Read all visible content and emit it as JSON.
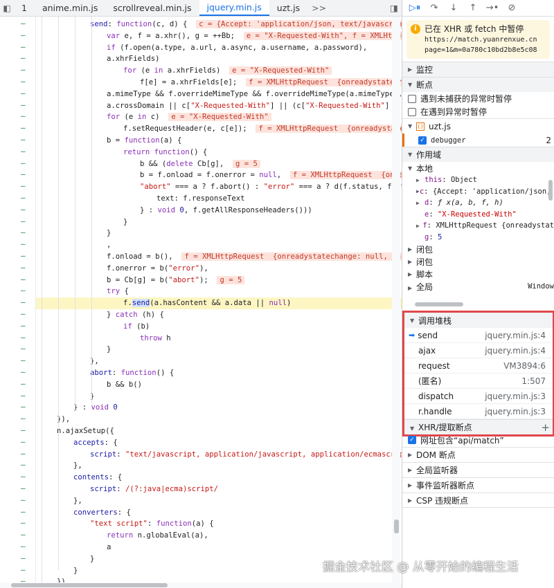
{
  "tabs": {
    "line_counter": "1",
    "items": [
      "anime.min.js",
      "scrollreveal.min.js",
      "jquery.min.js",
      "uzt.js"
    ],
    "more": ">>"
  },
  "code": {
    "lines": [
      [
        {
          "t": "send",
          "c": "fn"
        },
        {
          "t": ": "
        },
        {
          "t": "function",
          "c": "kw"
        },
        {
          "t": "(c, d) {  "
        },
        {
          "t": "c = {Accept: 'application/json, text/javascript, ",
          "c": "inl"
        }
      ],
      [
        {
          "t": "var",
          "c": "kw"
        },
        {
          "t": " e, f = a.xhr(), g = ++Bb;  "
        },
        {
          "t": "e = \"X-Requested-With\", f = XMLHttpRe",
          "c": "inl"
        }
      ],
      [
        {
          "t": "if",
          "c": "kw"
        },
        {
          "t": " (f.open(a.type, a.url, a.async, a.username, a.password),"
        }
      ],
      [
        {
          "t": "a.xhrFields)"
        }
      ],
      [
        {
          "t": "for",
          "c": "kw"
        },
        {
          "t": " (e "
        },
        {
          "t": "in",
          "c": "kw"
        },
        {
          "t": " a.xhrFields)  "
        },
        {
          "t": "e = \"X-Requested-With\"",
          "c": "inl"
        }
      ],
      [
        {
          "t": "f[e] = a.xhrFields[e];  "
        },
        {
          "t": "f = XMLHttpRequest  {onreadystatecha",
          "c": "inl"
        }
      ],
      [
        {
          "t": "a.mimeType && f.overrideMimeType && f.overrideMimeType(a.mimeType),"
        }
      ],
      [
        {
          "t": "a.crossDomain || c["
        },
        {
          "t": "\"X-Requested-With\"",
          "c": "str"
        },
        {
          "t": "] || (c["
        },
        {
          "t": "\"X-Requested-With\"",
          "c": "str"
        },
        {
          "t": "] = \"X"
        }
      ],
      [
        {
          "t": "for",
          "c": "kw"
        },
        {
          "t": " (e "
        },
        {
          "t": "in",
          "c": "kw"
        },
        {
          "t": " c)  "
        },
        {
          "t": "e = \"X-Requested-With\"",
          "c": "inl"
        }
      ],
      [
        {
          "t": "f.setRequestHeader(e, c[e]);  "
        },
        {
          "t": "f = XMLHttpRequest  {onreadystatec",
          "c": "inl"
        }
      ],
      [
        {
          "t": "b = "
        },
        {
          "t": "function",
          "c": "kw"
        },
        {
          "t": "(a) {"
        }
      ],
      [
        {
          "t": "return",
          "c": "kw"
        },
        {
          "t": " "
        },
        {
          "t": "function",
          "c": "kw"
        },
        {
          "t": "() {"
        }
      ],
      [
        {
          "t": "b && ("
        },
        {
          "t": "delete",
          "c": "kw"
        },
        {
          "t": " Cb[g],  "
        },
        {
          "t": "g = 5",
          "c": "inl"
        }
      ],
      [
        {
          "t": "b = f.onload = f.onerror = "
        },
        {
          "t": "null",
          "c": "kw"
        },
        {
          "t": ",  "
        },
        {
          "t": "f = XMLHttpRequest  {onrea",
          "c": "inl"
        }
      ],
      [
        {
          "t": "\"abort\"",
          "c": "str"
        },
        {
          "t": " === a ? f.abort() : "
        },
        {
          "t": "\"error\"",
          "c": "str"
        },
        {
          "t": " === a ? d(f.status, f.sta"
        }
      ],
      [
        {
          "t": "text: f.responseText"
        }
      ],
      [
        {
          "t": "} : "
        },
        {
          "t": "void",
          "c": "kw"
        },
        {
          "t": " "
        },
        {
          "t": "0",
          "c": "fn"
        },
        {
          "t": ", f.getAllResponseHeaders()))"
        }
      ],
      [
        {
          "t": "}"
        }
      ],
      [
        {
          "t": "}"
        }
      ],
      [
        {
          "t": ","
        }
      ],
      [
        {
          "t": "f.onload = b(),  "
        },
        {
          "t": "f = XMLHttpRequest  {onreadystatechange: null, read",
          "c": "inl"
        }
      ],
      [
        {
          "t": "f.onerror = b("
        },
        {
          "t": "\"error\"",
          "c": "str"
        },
        {
          "t": "),"
        }
      ],
      [
        {
          "t": "b = Cb[g] = b("
        },
        {
          "t": "\"abort\"",
          "c": "str"
        },
        {
          "t": ");  "
        },
        {
          "t": "g = 5",
          "c": "inl"
        }
      ],
      [
        {
          "t": "try",
          "c": "kw"
        },
        {
          "t": " {"
        }
      ],
      [
        {
          "t": "f."
        },
        {
          "t": "send",
          "c": "call"
        },
        {
          "t": "(a.hasContent && a.data || "
        },
        {
          "t": "null",
          "c": "kw"
        },
        {
          "t": ")"
        }
      ],
      [
        {
          "t": "} "
        },
        {
          "t": "catch",
          "c": "kw"
        },
        {
          "t": " (h) {"
        }
      ],
      [
        {
          "t": "if",
          "c": "kw"
        },
        {
          "t": " (b)"
        }
      ],
      [
        {
          "t": "throw",
          "c": "kw"
        },
        {
          "t": " h"
        }
      ],
      [
        {
          "t": "}"
        }
      ],
      [
        {
          "t": "},"
        }
      ],
      [
        {
          "t": "abort",
          "c": "fn"
        },
        {
          "t": ": "
        },
        {
          "t": "function",
          "c": "kw"
        },
        {
          "t": "() {"
        }
      ],
      [
        {
          "t": "b && b()"
        }
      ],
      [
        {
          "t": "}"
        }
      ],
      [
        {
          "t": "} : "
        },
        {
          "t": "void",
          "c": "kw"
        },
        {
          "t": " "
        },
        {
          "t": "0",
          "c": "fn"
        }
      ],
      [
        {
          "t": "}),"
        }
      ],
      [
        {
          "t": "n.ajaxSetup({"
        }
      ],
      [
        {
          "t": "accepts",
          "c": "fn"
        },
        {
          "t": ": {"
        }
      ],
      [
        {
          "t": "script",
          "c": "fn"
        },
        {
          "t": ": "
        },
        {
          "t": "\"text/javascript, application/javascript, application/ecmascript,",
          "c": "str"
        }
      ],
      [
        {
          "t": "},"
        }
      ],
      [
        {
          "t": "contents",
          "c": "fn"
        },
        {
          "t": ": {"
        }
      ],
      [
        {
          "t": "script",
          "c": "fn"
        },
        {
          "t": ": "
        },
        {
          "t": "/(?:java|ecma)script/",
          "c": "str"
        }
      ],
      [
        {
          "t": "},"
        }
      ],
      [
        {
          "t": "converters",
          "c": "fn"
        },
        {
          "t": ": {"
        }
      ],
      [
        {
          "t": "\"text script\"",
          "c": "str"
        },
        {
          "t": ": "
        },
        {
          "t": "function",
          "c": "kw"
        },
        {
          "t": "(a) {"
        }
      ],
      [
        {
          "t": "return",
          "c": "kw"
        },
        {
          "t": " n.globalEval(a),"
        }
      ],
      [
        {
          "t": "a"
        }
      ],
      [
        {
          "t": "}"
        }
      ],
      [
        {
          "t": "}"
        }
      ],
      [
        {
          "t": "}),"
        }
      ]
    ],
    "highlighted_line": 24
  },
  "toolbar": {
    "icons": [
      "resume-icon",
      "step-over-icon",
      "step-into-icon",
      "step-out-icon",
      "step-icon",
      "deactivate-breakpoints-icon"
    ]
  },
  "paused": {
    "title": "已在 XHR 或 fetch 中暂停",
    "url_line1": "https://match.yuanrenxue.cn",
    "url_line2": "page=1&m=0a780c10bd2b8e5c08"
  },
  "sections": {
    "watch": "监控",
    "breakpoints": "断点",
    "pause_uncaught": "遇到未捕获的异常时暂停",
    "pause_caught": "在遇到异常时暂停",
    "bp_file": "uzt.js",
    "bp_code": "debugger",
    "bp_line": "2",
    "scope": "作用域",
    "local": "本地",
    "closure1": "闭包",
    "closure2": "闭包",
    "script": "脚本",
    "global": "全局",
    "global_value": "Window"
  },
  "scope": {
    "this_key": "this",
    "this_val": "Object",
    "c_key": "c",
    "c_val": "{Accept: 'application/json, t",
    "d_key": "d",
    "d_val": "ƒ x(a, b, f, h)",
    "e_key": "e",
    "e_val": "\"X-Requested-With\"",
    "f_key": "f",
    "f_val": "XMLHttpRequest  {onreadystat",
    "g_key": "g",
    "g_val": "5"
  },
  "call_stack": {
    "header": "调用堆栈",
    "frames": [
      {
        "name": "send",
        "loc": "jquery.min.js:4"
      },
      {
        "name": "ajax",
        "loc": "jquery.min.js:4"
      },
      {
        "name": "request",
        "loc": "VM3894:6"
      },
      {
        "name": "(匿名)",
        "loc": "1:507"
      },
      {
        "name": "dispatch",
        "loc": "jquery.min.js:3"
      },
      {
        "name": "r.handle",
        "loc": "jquery.min.js:3"
      }
    ]
  },
  "lower": {
    "xhr_breakpoints": "XHR/提取断点",
    "add": "+",
    "url_contains": "网址包含“api/match”",
    "dom_breakpoints": "DOM 断点",
    "global_listeners": "全局监听器",
    "event_listener_breakpoints": "事件监听器断点",
    "csp_breakpoints": "CSP 违规断点"
  },
  "watermark": "掘金技术社区 @ 从零开始的编程生活",
  "colors": {
    "highlight_line": "#fdf6c3",
    "inline_value": "#fde3dc",
    "keyword": "#8a2fb8",
    "string": "#c41a16",
    "accent": "#1a73e8",
    "callstack_outline": "#e0474c"
  }
}
